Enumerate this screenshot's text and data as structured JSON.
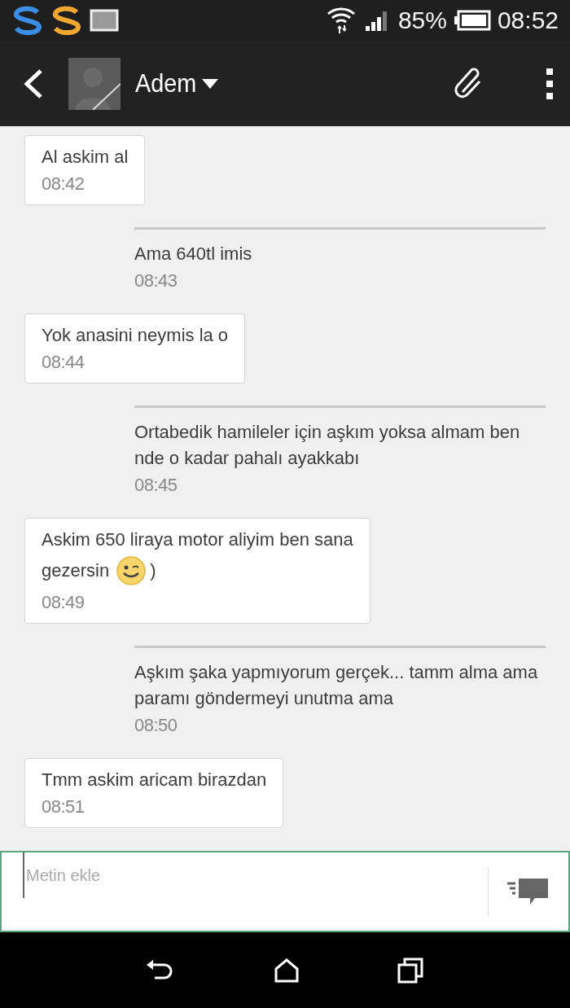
{
  "status_bar": {
    "battery": "85%",
    "time": "08:52"
  },
  "header": {
    "contact": "Adem"
  },
  "messages": [
    {
      "kind": "received",
      "text": "Al askim al",
      "time": "08:42"
    },
    {
      "kind": "sent",
      "text": "Ama 640tl imis",
      "time": "08:43"
    },
    {
      "kind": "received",
      "text": "Yok anasini neymis la o",
      "time": "08:44"
    },
    {
      "kind": "sent",
      "text": "Ortabedik hamileler  için aşkım yoksa almam ben nde o kadar pahalı ayakkabı",
      "time": "08:45"
    },
    {
      "kind": "received",
      "text": "Askim 650 liraya motor aliyim ben sana",
      "text_before_emoji": "gezersin",
      "emoji": {
        "kind": "wink"
      },
      "text_after": ")",
      "time": "08:49"
    },
    {
      "kind": "sent",
      "text": "Aşkım şaka yapmıyorum gerçek... tamm alma ama paramı göndermeyi unutma ama",
      "time": "08:50"
    },
    {
      "kind": "received",
      "text": "Tmm askim aricam birazdan",
      "time": "08:51"
    }
  ],
  "composer": {
    "placeholder": "Metin ekle"
  }
}
